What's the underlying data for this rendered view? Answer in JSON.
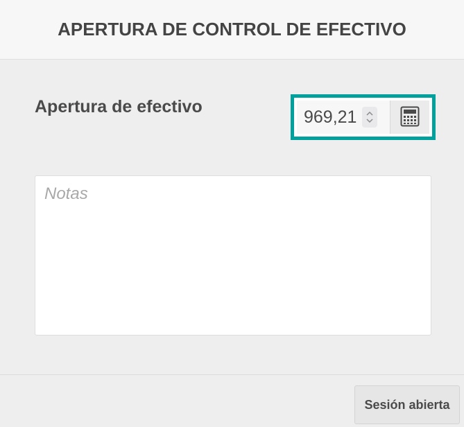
{
  "header": {
    "title": "APERTURA DE CONTROL DE EFECTIVO"
  },
  "opening": {
    "label": "Apertura de efectivo",
    "amount": "969,21",
    "spinner_icon": "chevron-up-down-icon",
    "calculator_icon": "calculator-icon"
  },
  "notes": {
    "placeholder": "Notas",
    "value": ""
  },
  "footer": {
    "session_button_label": "Sesión abierta"
  },
  "colors": {
    "accent": "#00a09d",
    "background": "#efeeee",
    "header_background": "#f7f7f7",
    "text": "#4a4a4a"
  }
}
